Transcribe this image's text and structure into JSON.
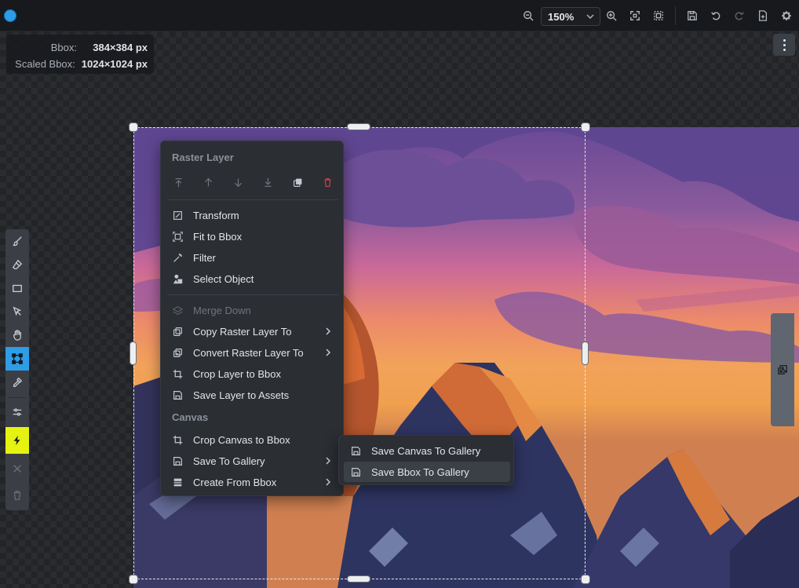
{
  "toolbar": {
    "zoom_value": "150%"
  },
  "bbox_info": {
    "bbox_label": "Bbox:",
    "bbox_value": "384×384 px",
    "scaled_label": "Scaled Bbox:",
    "scaled_value": "1024×1024 px"
  },
  "context_menu": {
    "raster_title": "Raster Layer",
    "items": [
      {
        "label": "Transform"
      },
      {
        "label": "Fit to Bbox"
      },
      {
        "label": "Filter"
      },
      {
        "label": "Select Object"
      },
      {
        "label": "Merge Down"
      },
      {
        "label": "Copy Raster Layer To"
      },
      {
        "label": "Convert Raster Layer To"
      },
      {
        "label": "Crop Layer to Bbox"
      },
      {
        "label": "Save Layer to Assets"
      }
    ],
    "canvas_title": "Canvas",
    "canvas_items": [
      {
        "label": "Crop Canvas to Bbox"
      },
      {
        "label": "Save To Gallery"
      },
      {
        "label": "Create From Bbox"
      }
    ]
  },
  "submenu": {
    "items": [
      {
        "label": "Save Canvas To Gallery"
      },
      {
        "label": "Save Bbox To Gallery"
      }
    ]
  },
  "colors": {
    "accent": "#2f9ce6",
    "invoke": "#e6f20f",
    "danger": "#b74850"
  }
}
